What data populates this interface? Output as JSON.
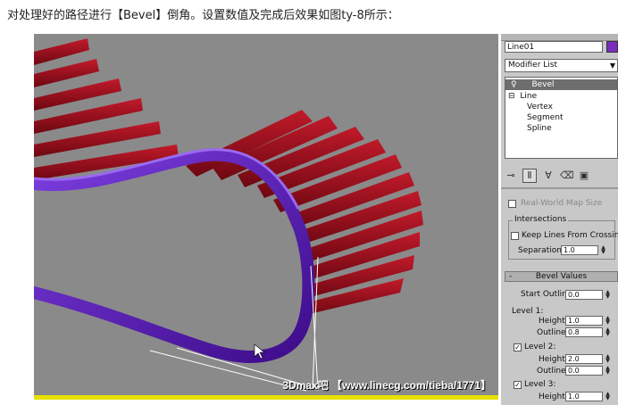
{
  "caption": "对处理好的路径进行【Bevel】倒角。设置数值及完成后效果如图ty-8所示：",
  "watermark": "3Dmax吧  【www.linecg.com/tieba/1771】",
  "panel": {
    "object_name": "Line01",
    "object_color": "#7a2dbd",
    "modifier_list": "Modifier List",
    "stack": [
      "Bevel",
      "Line",
      "Vertex",
      "Segment",
      "Spline"
    ],
    "real_world": "Real-World Map Size",
    "intersections_title": "Intersections",
    "keep_lines": "Keep Lines From Crossing",
    "separation_label": "Separation:",
    "separation_value": "1.0",
    "bevel_values_title": "Bevel Values",
    "start_outline_label": "Start Outline:",
    "start_outline_value": "0.0",
    "level1_label": "Level 1:",
    "level1_height_label": "Height:",
    "level1_height": "1.0",
    "level1_outline_label": "Outline:",
    "level1_outline": "0.8",
    "level2_label": "Level 2:",
    "level2_height_label": "Height:",
    "level2_height": "2.0",
    "level2_outline_label": "Outline:",
    "level2_outline": "0.0",
    "level3_label": "Level 3:",
    "level3_height_label": "Height:",
    "level3_height": "1.0"
  },
  "colors": {
    "viewport_bg": "#8a8a8a",
    "slat": "#9b0f1e",
    "rail": "#5a16b4"
  }
}
